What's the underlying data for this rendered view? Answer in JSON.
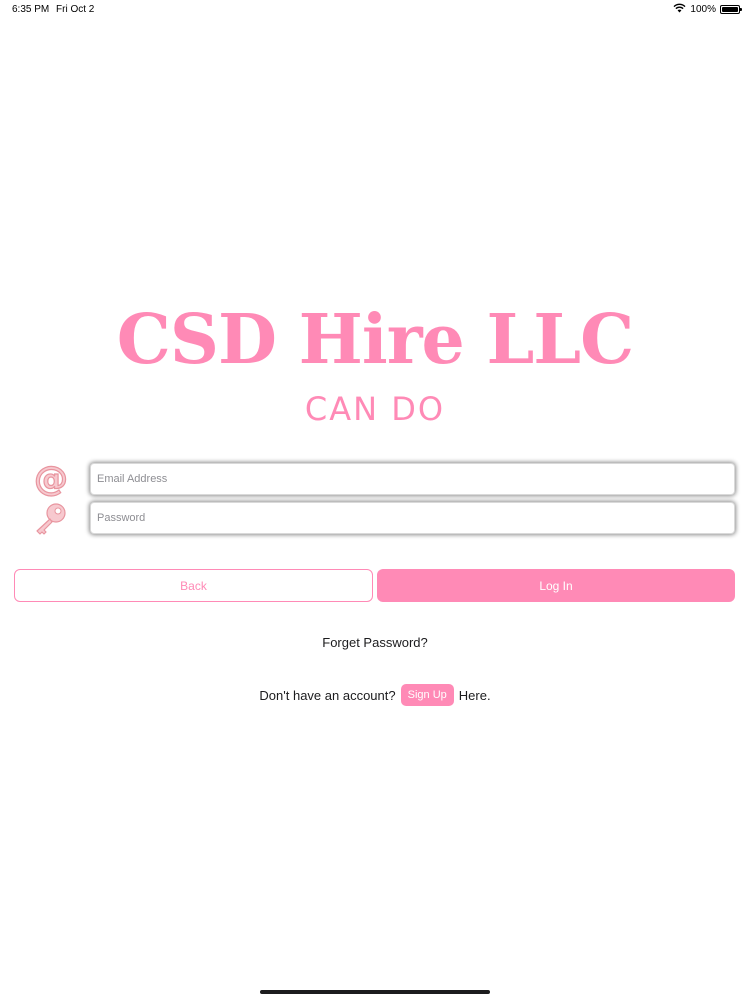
{
  "status_bar": {
    "time": "6:35 PM",
    "date": "Fri Oct 2",
    "battery_text": "100%",
    "battery_level": 1.0
  },
  "logo": {
    "title": "CSD Hire LLC",
    "subtitle": "CAN DO"
  },
  "form": {
    "email": {
      "icon": "at-sign-icon",
      "placeholder": "Email Address",
      "value": ""
    },
    "password": {
      "icon": "key-icon",
      "placeholder": "Password",
      "value": ""
    }
  },
  "buttons": {
    "back_label": "Back",
    "login_label": "Log In"
  },
  "forgot_password": "Forget Password?",
  "signup": {
    "prefix": "Don't have an account?",
    "button_label": "Sign Up",
    "suffix": "Here."
  },
  "colors": {
    "accent": "#ff8ab6",
    "icon_fill": "#f7c9cf",
    "icon_stroke": "#e8959f"
  }
}
